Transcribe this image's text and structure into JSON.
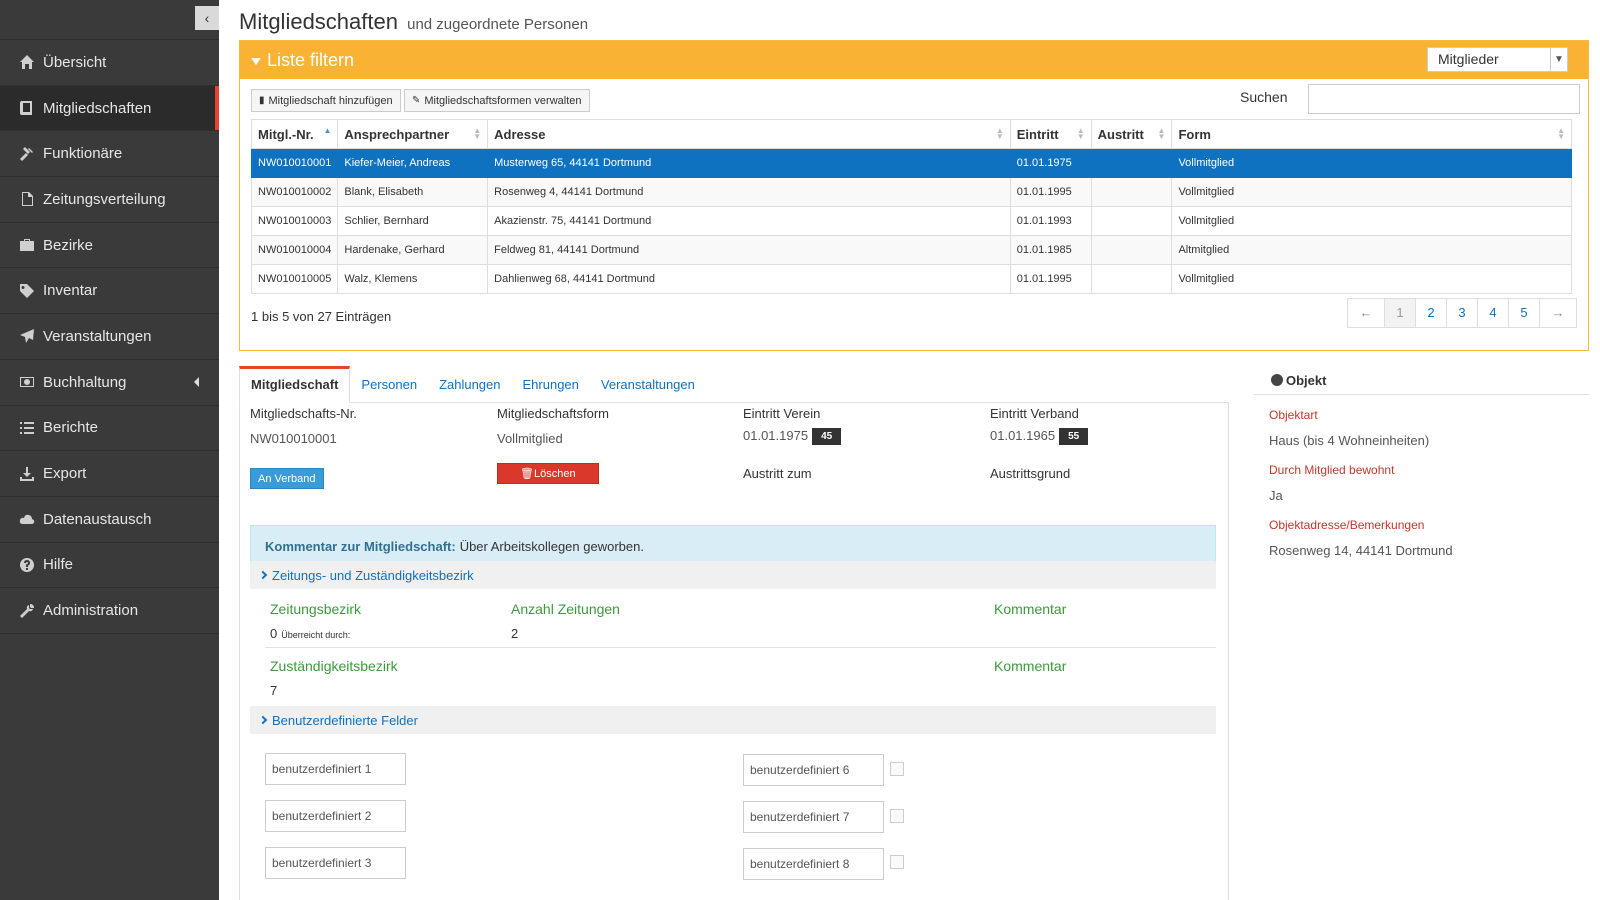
{
  "sidebar": {
    "collapse_glyph": "‹",
    "items": [
      {
        "label": "Übersicht",
        "icon": "home-icon"
      },
      {
        "label": "Mitgliedschaften",
        "icon": "book-icon"
      },
      {
        "label": "Funktionäre",
        "icon": "gavel-icon"
      },
      {
        "label": "Zeitungsverteilung",
        "icon": "file-icon"
      },
      {
        "label": "Bezirke",
        "icon": "briefcase-icon"
      },
      {
        "label": "Inventar",
        "icon": "tags-icon"
      },
      {
        "label": "Veranstaltungen",
        "icon": "plane-icon"
      },
      {
        "label": "Buchhaltung",
        "icon": "money-icon"
      },
      {
        "label": "Berichte",
        "icon": "list-icon"
      },
      {
        "label": "Export",
        "icon": "download-icon"
      },
      {
        "label": "Datenaustausch",
        "icon": "cloud-icon"
      },
      {
        "label": "Hilfe",
        "icon": "question-icon"
      },
      {
        "label": "Administration",
        "icon": "wrench-icon"
      }
    ]
  },
  "page": {
    "title": "Mitgliedschaften",
    "subtitle": "und zugeordnete Personen"
  },
  "filter": {
    "title": "Liste filtern",
    "select_value": "Mitglieder",
    "add_button": "Mitgliedschaft hinzufügen",
    "manage_button": "Mitgliedschaftsformen verwalten",
    "search_label": "Suchen",
    "search_value": ""
  },
  "table": {
    "columns": [
      "Mitgl.-Nr.",
      "Ansprechpartner",
      "Adresse",
      "Eintritt",
      "Austritt",
      "Form"
    ],
    "rows": [
      {
        "nr": "NW010010001",
        "name": "Kiefer-Meier, Andreas",
        "adresse": "Musterweg 65, 44141 Dortmund",
        "eintritt": "01.01.1975",
        "austritt": "",
        "form": "Vollmitglied"
      },
      {
        "nr": "NW010010002",
        "name": "Blank, Elisabeth",
        "adresse": "Rosenweg 4, 44141 Dortmund",
        "eintritt": "01.01.1995",
        "austritt": "",
        "form": "Vollmitglied"
      },
      {
        "nr": "NW010010003",
        "name": "Schlier, Bernhard",
        "adresse": "Akazienstr. 75, 44141 Dortmund",
        "eintritt": "01.01.1993",
        "austritt": "",
        "form": "Vollmitglied"
      },
      {
        "nr": "NW010010004",
        "name": "Hardenake, Gerhard",
        "adresse": "Feldweg 81, 44141 Dortmund",
        "eintritt": "01.01.1985",
        "austritt": "",
        "form": "Altmitglied"
      },
      {
        "nr": "NW010010005",
        "name": "Walz, Klemens",
        "adresse": "Dahlienweg 68, 44141 Dortmund",
        "eintritt": "01.01.1995",
        "austritt": "",
        "form": "Vollmitglied"
      }
    ],
    "info": "1 bis 5 von 27 Einträgen"
  },
  "pagination": {
    "prev": "←",
    "pages": [
      "1",
      "2",
      "3",
      "4",
      "5"
    ],
    "next": "→"
  },
  "tabs": [
    "Mitgliedschaft",
    "Personen",
    "Zahlungen",
    "Ehrungen",
    "Veranstaltungen"
  ],
  "detail": {
    "nr_label": "Mitgliedschafts-Nr.",
    "nr_value": "NW010010001",
    "form_label": "Mitgliedschaftsform",
    "form_value": "Vollmitglied",
    "eintritt_verein_label": "Eintritt Verein",
    "eintritt_verein_value": "01.01.1975",
    "eintritt_verein_badge": "45",
    "eintritt_verband_label": "Eintritt Verband",
    "eintritt_verband_value": "01.01.1965",
    "eintritt_verband_badge": "55",
    "an_verband_button": "An Verband",
    "loeschen_button": "Löschen",
    "austritt_label": "Austritt zum",
    "austrittsgrund_label": "Austrittsgrund",
    "comment_label": "Kommentar zur Mitgliedschaft:",
    "comment_text": "Über Arbeitskollegen geworben.",
    "section_zeitung": "Zeitungs- und Zuständigkeitsbezirk",
    "zeitungsbezirk_label": "Zeitungsbezirk",
    "zeitungsbezirk_value": "0",
    "ueberreicht_label": "Überreicht durch:",
    "anzahl_label": "Anzahl Zeitungen",
    "anzahl_value": "2",
    "kommentar_label": "Kommentar",
    "zustaendig_label": "Zuständigkeitsbezirk",
    "zustaendig_value": "7",
    "kommentar2_label": "Kommentar",
    "section_custom": "Benutzerdefinierte Felder",
    "custom_fields": [
      "benutzerdefiniert 1",
      "benutzerdefiniert 2",
      "benutzerdefiniert 3",
      "benutzerdefiniert 6",
      "benutzerdefiniert 7",
      "benutzerdefiniert 8"
    ]
  },
  "object": {
    "title": "Objekt",
    "objektart_label": "Objektart",
    "objektart_value": "Haus (bis 4 Wohneinheiten)",
    "bewohnt_label": "Durch Mitglied bewohnt",
    "bewohnt_value": "Ja",
    "adresse_label": "Objektadresse/Bemerkungen",
    "adresse_value": "Rosenweg 14, 44141 Dortmund"
  },
  "colors": {
    "sidebar_bg": "#3a3a3a",
    "accent_red": "#e8412d",
    "filter_orange": "#f9b233",
    "selected_blue": "#0e72c0",
    "green_label": "#3c9a3c"
  }
}
